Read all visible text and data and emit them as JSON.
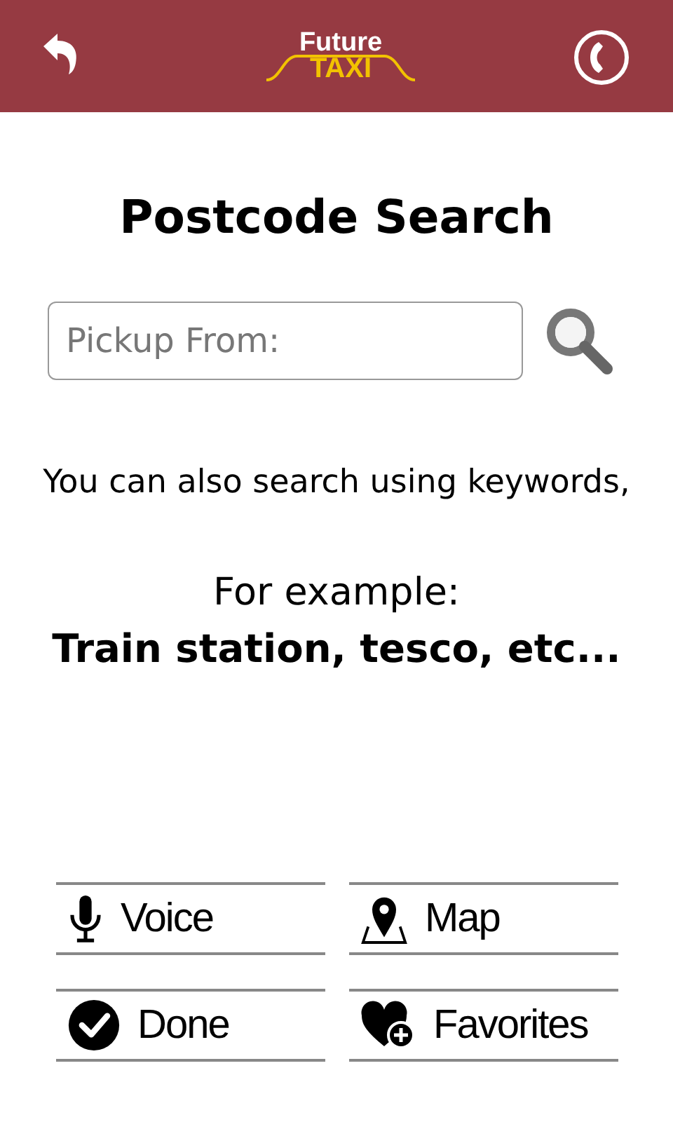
{
  "header": {
    "logo_top": "Future",
    "logo_bottom": "TAXI"
  },
  "title": "Postcode Search",
  "search": {
    "placeholder": "Pickup From:"
  },
  "hint": "You can also search using keywords,",
  "example_label": "For example:",
  "example_text": "Train station, tesco, etc...",
  "buttons": [
    {
      "kind": "voice",
      "label": "Voice"
    },
    {
      "kind": "map",
      "label": "Map"
    },
    {
      "kind": "done",
      "label": "Done"
    },
    {
      "kind": "favorites",
      "label": "Favorites"
    }
  ]
}
